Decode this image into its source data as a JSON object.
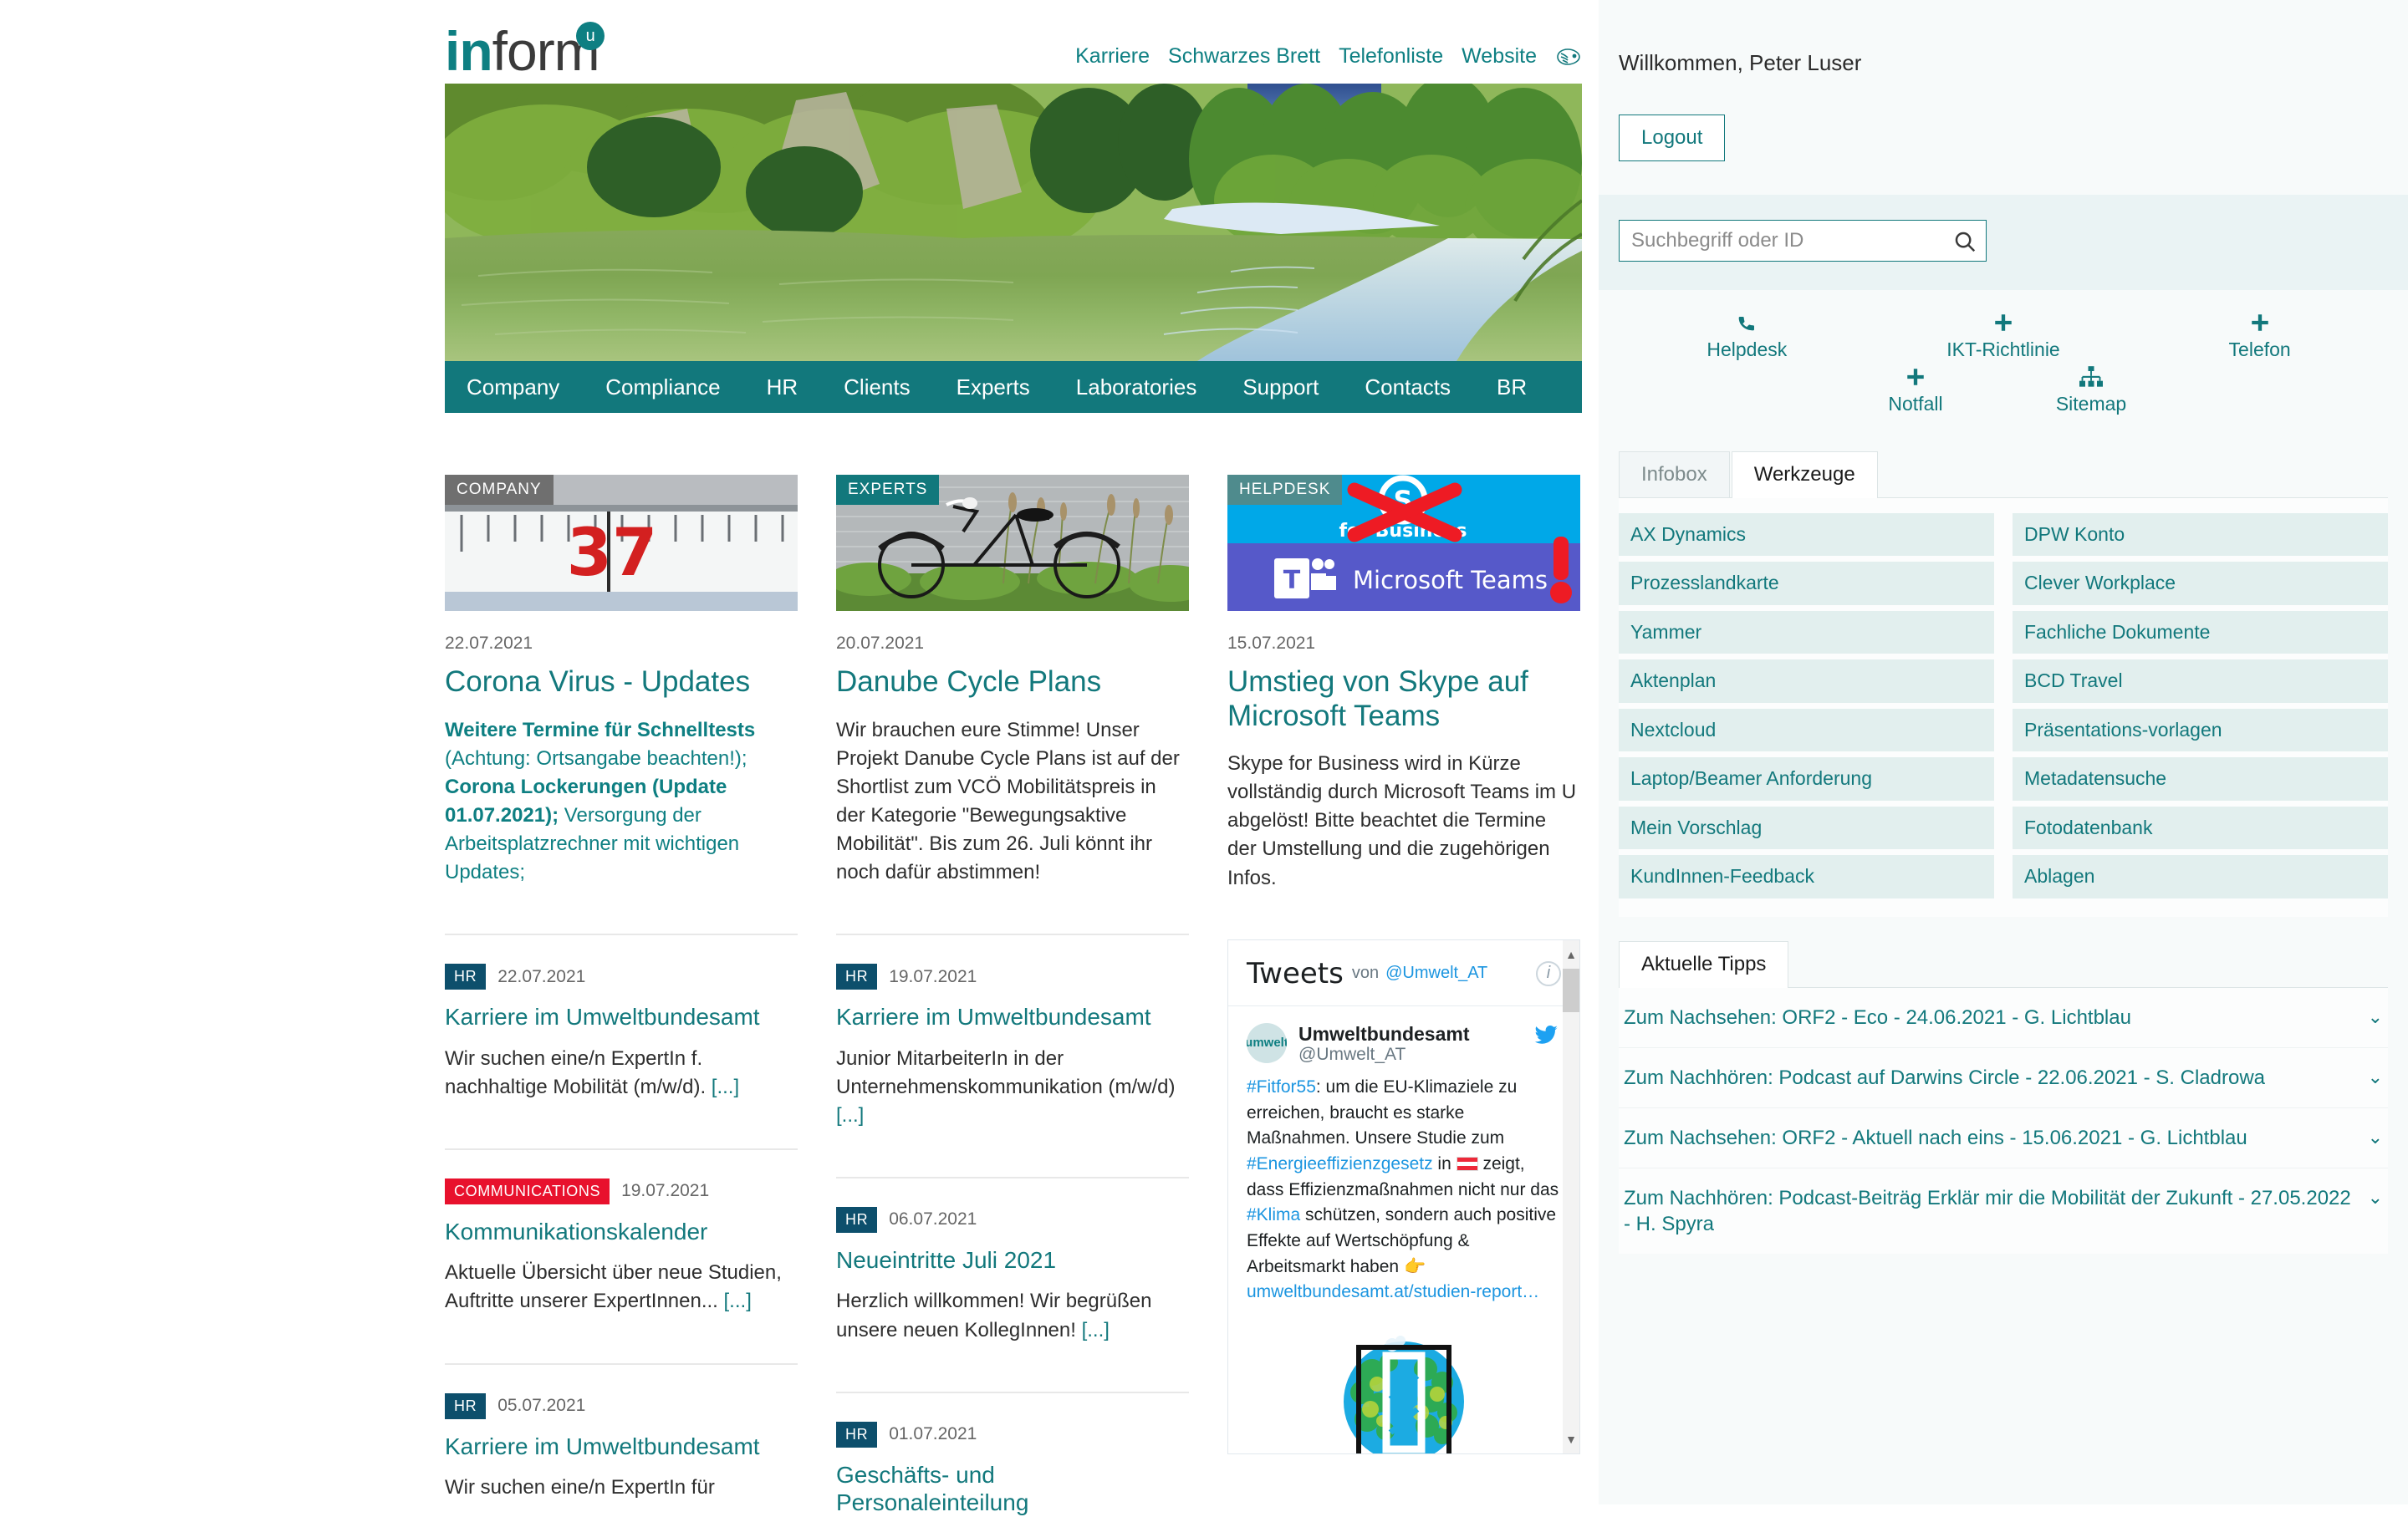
{
  "header": {
    "logo_in": "in",
    "logo_form": "form",
    "logo_badge": "u",
    "nav": [
      {
        "label": "Karriere"
      },
      {
        "label": "Schwarzes Brett"
      },
      {
        "label": "Telefonliste"
      },
      {
        "label": "Website"
      }
    ],
    "website_icon": "umweltbundesamt-logo-icon"
  },
  "main_nav": [
    {
      "label": "Company"
    },
    {
      "label": "Compliance"
    },
    {
      "label": "HR"
    },
    {
      "label": "Clients"
    },
    {
      "label": "Experts"
    },
    {
      "label": "Laboratories"
    },
    {
      "label": "Support"
    },
    {
      "label": "Contacts"
    },
    {
      "label": "BR"
    }
  ],
  "hero": {
    "alt": "river-landscape-photo"
  },
  "cards": [
    {
      "category": "COMPANY",
      "category_color": "#6f6f6f",
      "image": "thermometer-37-photo",
      "date": "22.07.2021",
      "title": "Corona Virus - Updates",
      "text_bold_1": "Weitere Termine für Schnelltests",
      "text_plain_1": "(Achtung: Ortsangabe beachten!); ",
      "text_bold_2": "Corona Lockerungen (Update 01.07.2021); ",
      "text_plain_2": "Versorgung der Arbeitsplatzrechner mit wichtigen Updates;"
    },
    {
      "category": "EXPERTS",
      "category_color": "#12787c",
      "image": "bicycle-by-lake-photo",
      "date": "20.07.2021",
      "title": "Danube Cycle Plans",
      "text": "Wir brauchen eure Stimme! Unser Projekt Danube Cycle Plans ist auf der Shortlist zum VCÖ Mobilitätspreis in der Kategorie \"Bewegungsaktive Mobilität\". Bis zum 26. Juli könnt ihr noch dafür abstimmen!"
    },
    {
      "category": "HELPDESK",
      "category_color": "#4f8b8d",
      "image": "skype-to-teams-graphic",
      "date": "15.07.2021",
      "title": "Umstieg von Skype auf Microsoft Teams",
      "text": "Skype for Business wird in Kürze vollständig durch Microsoft Teams im U abgelöst! Bitte beachtet die Termine der Umstellung und die zugehörigen Infos."
    }
  ],
  "news_col1": [
    {
      "badge": "HR",
      "badge_type": "hr",
      "date": "22.07.2021",
      "title": "Karriere im Umweltbundesamt",
      "text": "Wir suchen eine/n ExpertIn f. nachhaltige Mobilität (m/w/d). ",
      "more": "[...]"
    },
    {
      "badge": "COMMUNICATIONS",
      "badge_type": "comm",
      "date": "19.07.2021",
      "title": "Kommunikationskalender",
      "text": "Aktuelle Übersicht über neue Studien, Auftritte unserer ExpertInnen... ",
      "more": "[...]"
    },
    {
      "badge": "HR",
      "badge_type": "hr",
      "date": "05.07.2021",
      "title": "Karriere im Umweltbundesamt",
      "text": "Wir suchen eine/n ExpertIn für ",
      "more": ""
    }
  ],
  "news_col2": [
    {
      "badge": "HR",
      "badge_type": "hr",
      "date": "19.07.2021",
      "title": "Karriere im Umweltbundesamt",
      "text": "Junior MitarbeiterIn in der Unternehmenskommunikation (m/w/d) ",
      "more": "[...]"
    },
    {
      "badge": "HR",
      "badge_type": "hr",
      "date": "06.07.2021",
      "title": "Neueintritte Juli 2021",
      "text": "Herzlich willkommen! Wir begrüßen unsere neuen KollegInnen! ",
      "more": "[...]"
    },
    {
      "badge": "HR",
      "badge_type": "hr",
      "date": "01.07.2021",
      "title": "Geschäfts- und Personaleinteilung",
      "text": "",
      "more": ""
    }
  ],
  "twitter": {
    "heading": "Tweets",
    "von": "von",
    "account": "@Umwelt_AT",
    "info_icon": "info-icon",
    "author_name": "Umweltbundesamt",
    "author_handle": "@Umwelt_AT",
    "avatar_text": "umwelt",
    "bird_icon": "twitter-bird-icon",
    "tag1": "#Fitfor55",
    "text1": ": um die EU-Klimaziele zu erreichen, braucht es starke Maßnahmen. Unsere Studie zum ",
    "tag2": "#Energieeffizienzgesetz",
    "text2": " in ",
    "flag": "austria-flag-icon",
    "text3": " zeigt, dass Effizienzmaßnahmen nicht nur das ",
    "tag3": "#Klima",
    "text4": " schützen, sondern auch positive Effekte auf Wertschöpfung & Arbeitsmarkt haben ",
    "emoji": "👉",
    "link": "umweltbundesamt.at/studien-report…",
    "media": "sdg-globe-graphic"
  },
  "sidebar": {
    "welcome": "Willkommen, Peter Luser",
    "logout_label": "Logout",
    "search_placeholder": "Suchbegriff oder ID",
    "search_value": "",
    "search_icon": "search-icon",
    "quick_links_row1": [
      {
        "label": "Helpdesk",
        "icon": "phone-icon"
      },
      {
        "label": "IKT-Richtlinie",
        "icon": "plus-icon"
      },
      {
        "label": "Telefon",
        "icon": "plus-icon"
      }
    ],
    "quick_links_row2": [
      {
        "label": "Notfall",
        "icon": "plus-icon"
      },
      {
        "label": "Sitemap",
        "icon": "sitemap-icon"
      }
    ],
    "tabs": [
      {
        "label": "Infobox",
        "active": false
      },
      {
        "label": "Werkzeuge",
        "active": true
      }
    ],
    "tools_left": [
      {
        "label": "AX Dynamics"
      },
      {
        "label": "Prozesslandkarte"
      },
      {
        "label": "Yammer"
      },
      {
        "label": "Aktenplan"
      },
      {
        "label": "Nextcloud"
      },
      {
        "label": "Laptop/Beamer Anforderung"
      },
      {
        "label": "Mein Vorschlag"
      },
      {
        "label": "KundInnen-Feedback"
      }
    ],
    "tools_right": [
      {
        "label": "DPW Konto"
      },
      {
        "label": "Clever Workplace"
      },
      {
        "label": "Fachliche Dokumente"
      },
      {
        "label": "BCD Travel"
      },
      {
        "label": "Präsentations-vorlagen"
      },
      {
        "label": "Metadatensuche"
      },
      {
        "label": "Fotodatenbank"
      },
      {
        "label": "Ablagen"
      }
    ],
    "tipps_tab": "Aktuelle Tipps",
    "tipps": [
      {
        "text": "Zum Nachsehen: ORF2 - Eco - 24.06.2021 - G. Lichtblau"
      },
      {
        "text": "Zum Nachhören: Podcast auf Darwins Circle - 22.06.2021 - S. Cladrowa"
      },
      {
        "text": "Zum Nachsehen: ORF2 - Aktuell nach eins - 15.06.2021 - G. Lichtblau"
      },
      {
        "text": "Zum Nachhören: Podcast-Beiträg Erklär mir die Mobilität der Zukunft - 27.05.2022 - H. Spyra"
      }
    ]
  },
  "colors": {
    "accent": "#12787c",
    "badge_hr": "#0d4f6c",
    "badge_comm": "#e8112d",
    "sidebar_bg": "#f7fafa",
    "tool_bg": "#e2efee"
  }
}
